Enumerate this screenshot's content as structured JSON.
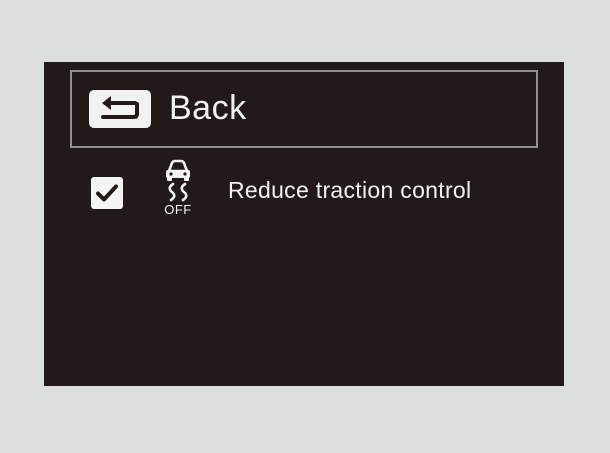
{
  "menu": {
    "back_label": "Back",
    "back_icon": "back-arrow-icon"
  },
  "option": {
    "label": "Reduce traction control",
    "checked": true,
    "checkbox_icon": "checkmark-icon",
    "icon": "traction-control-off-icon",
    "icon_text": "OFF"
  },
  "colors": {
    "screen_background": "#221a18",
    "page_background": "#dcdfde",
    "text": "#f2f2f2",
    "border": "#8e918f"
  }
}
